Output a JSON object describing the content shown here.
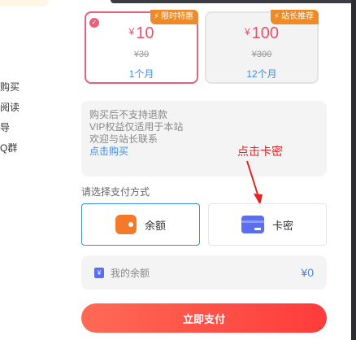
{
  "background_sidebar": {
    "links": [
      "购买",
      "阅读",
      "导",
      "Q群"
    ]
  },
  "plans": [
    {
      "badge": "限时特惠",
      "currency": "¥",
      "price": "10",
      "original": "¥30",
      "duration": "1个月",
      "selected": true
    },
    {
      "badge": "站长推荐",
      "currency": "¥",
      "price": "100",
      "original": "¥300",
      "duration": "12个月",
      "selected": false
    }
  ],
  "notice": {
    "lines": [
      "购买后不支持退款",
      "VIP权益仅适用于本站",
      "欢迎与站长联系"
    ],
    "link": "点击购买"
  },
  "annotation": "点击卡密",
  "payment": {
    "section_label": "请选择支付方式",
    "methods": [
      {
        "label": "余额",
        "icon": "wallet-icon",
        "selected": true
      },
      {
        "label": "卡密",
        "icon": "card-icon",
        "selected": false
      }
    ]
  },
  "balance": {
    "label": "我的余额",
    "value": "¥0"
  },
  "pay_button": "立即支付",
  "colors": {
    "accent_blue": "#3d8be8",
    "price_red": "#ee4f6a",
    "badge_orange": "#f08a24",
    "button_red": "#ff3b3b"
  }
}
